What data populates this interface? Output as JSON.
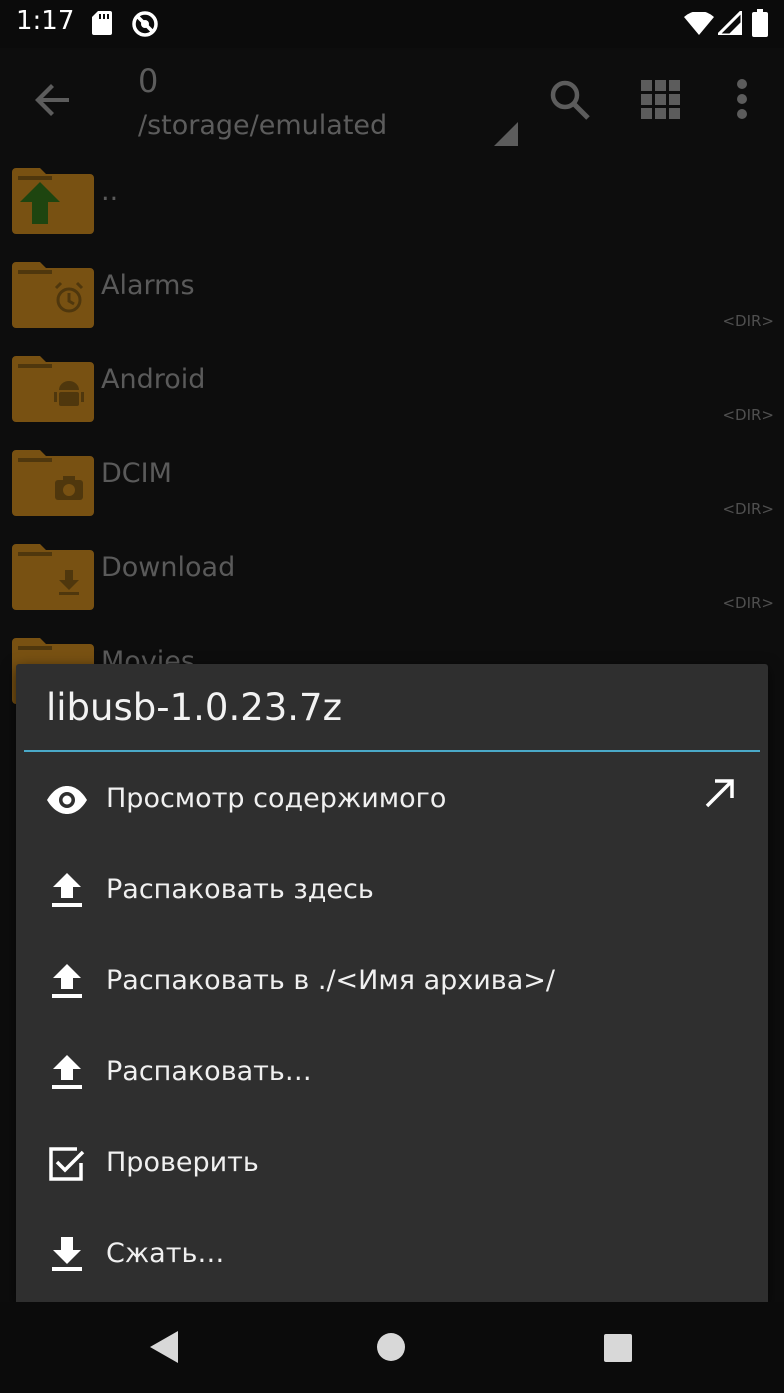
{
  "status_bar": {
    "time": "1:17",
    "icons": [
      "sd-card-icon",
      "do-not-disturb-icon",
      "wifi-icon",
      "cell-signal-icon",
      "battery-icon"
    ]
  },
  "toolbar": {
    "count": "0",
    "path": "/storage/emulated",
    "icons": [
      "back-arrow-icon",
      "search-icon",
      "grid-view-icon",
      "more-vert-icon"
    ]
  },
  "file_list": [
    {
      "name": "..",
      "tag": "",
      "icon": "folder-up-icon"
    },
    {
      "name": "Alarms",
      "tag": "<DIR>",
      "icon": "alarm-icon"
    },
    {
      "name": "Android",
      "tag": "<DIR>",
      "icon": "android-icon"
    },
    {
      "name": "DCIM",
      "tag": "<DIR>",
      "icon": "camera-icon"
    },
    {
      "name": "Download",
      "tag": "<DIR>",
      "icon": "download-icon"
    },
    {
      "name": "Movies",
      "tag": "",
      "icon": "folder-icon"
    }
  ],
  "dialog": {
    "title": "libusb-1.0.23.7z",
    "accent_color": "#4aa9c8",
    "items": [
      {
        "label": "Просмотр содержимого",
        "icon": "eye-icon"
      },
      {
        "label": "Распаковать здесь",
        "icon": "extract-icon"
      },
      {
        "label": "Распаковать в ./<Имя архива>/",
        "icon": "extract-icon"
      },
      {
        "label": "Распаковать…",
        "icon": "extract-icon"
      },
      {
        "label": "Проверить",
        "icon": "checkbox-icon"
      },
      {
        "label": "Сжать…",
        "icon": "compress-icon"
      }
    ]
  },
  "nav_bar": {
    "icons": [
      "nav-back-icon",
      "nav-home-icon",
      "nav-recent-icon"
    ]
  }
}
